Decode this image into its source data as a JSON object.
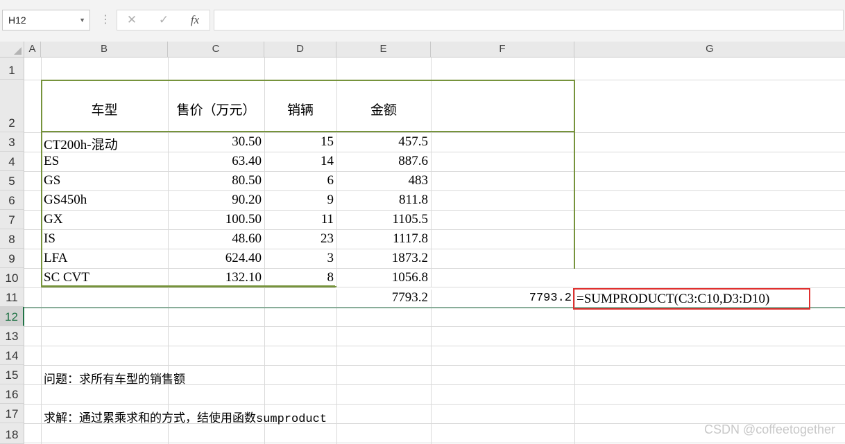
{
  "formula_bar": {
    "name_box": "H12",
    "cancel_icon": "✕",
    "enter_icon": "✓",
    "fx_icon": "fx",
    "content": ""
  },
  "columns": [
    "A",
    "B",
    "C",
    "D",
    "E",
    "F",
    "G"
  ],
  "rows": [
    "1",
    "2",
    "3",
    "4",
    "5",
    "6",
    "7",
    "8",
    "9",
    "10",
    "11",
    "12",
    "13",
    "14",
    "15",
    "16",
    "17",
    "18"
  ],
  "active_row": "12",
  "table": {
    "headers": [
      "车型",
      "售价（万元）",
      "销辆",
      "金额"
    ],
    "rows": [
      [
        "CT200h-混动",
        "30.50",
        "15",
        "457.5"
      ],
      [
        "ES",
        "63.40",
        "14",
        "887.6"
      ],
      [
        "GS",
        "80.50",
        "6",
        "483"
      ],
      [
        "GS450h",
        "90.20",
        "9",
        "811.8"
      ],
      [
        "GX",
        "100.50",
        "11",
        "1105.5"
      ],
      [
        "IS",
        "48.60",
        "23",
        "1117.8"
      ],
      [
        "LFA",
        "624.40",
        "3",
        "1873.2"
      ],
      [
        "SC CVT",
        "132.10",
        "8",
        "1056.8"
      ]
    ]
  },
  "totals": {
    "e11": "7793.2",
    "f11": "7793.2",
    "g11_formula": "=SUMPRODUCT(C3:C10,D3:D10)"
  },
  "notes": {
    "b15": "问题：求所有车型的销售额",
    "b17": "求解：通过累乘求和的方式，结使用函数sumproduct"
  },
  "watermark": "CSDN @coffeetogether",
  "colors": {
    "table_border": "#76933c",
    "callout_border": "#e0302f",
    "active_accent": "#217346"
  }
}
